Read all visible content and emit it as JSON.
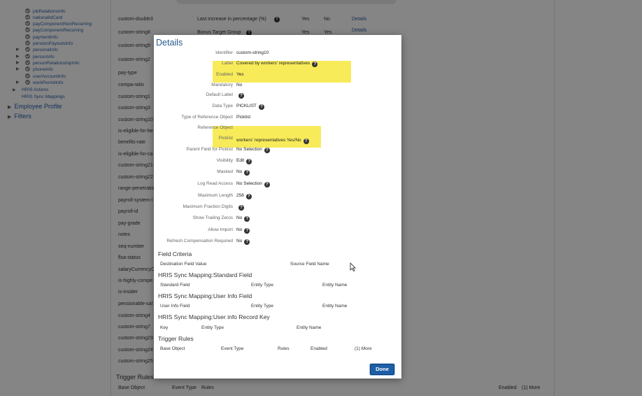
{
  "colors": {
    "link": "#2a5ea8",
    "highlight": "#f7eb5a",
    "done_button": "#1d5fa7",
    "title": "#2a5a8e"
  },
  "sidebar": {
    "tree_items": [
      {
        "label": "jobRelationsInfo",
        "arrow": false
      },
      {
        "label": "nationalIdCard",
        "arrow": false
      },
      {
        "label": "payComponentNonRecurring",
        "arrow": false
      },
      {
        "label": "payComponentRecurring",
        "arrow": false
      },
      {
        "label": "paymentInfo",
        "arrow": false
      },
      {
        "label": "pensionPayoutsInfo",
        "arrow": false
      },
      {
        "label": "personalInfo",
        "arrow": true
      },
      {
        "label": "personInfo",
        "arrow": true
      },
      {
        "label": "personRelationshipInfo",
        "arrow": true
      },
      {
        "label": "phoneInfo",
        "arrow": true
      },
      {
        "label": "userAccountInfo",
        "arrow": false
      },
      {
        "label": "workPermitInfo",
        "arrow": true
      }
    ],
    "hris_actions": "HRIS Actions",
    "hris_sync": "HRIS Sync Mappings",
    "employee_profile": "Employee Profile",
    "filters": "Filters"
  },
  "background": {
    "field_ids": [
      "custom-double3",
      "custom-string8",
      "custom-string9",
      "custom-string2",
      "pay-type",
      "compa-ratio",
      "custom-string1",
      "custom-string3",
      "custom-string10",
      "is-eligible-for-be",
      "benefits-rate",
      "is-eligible-for-ca",
      "custom-string21",
      "custom-string22",
      "range-penetratio",
      "payroll-system-i",
      "payroll-id",
      "pay-grade",
      "notes",
      "seq-number",
      "flsa-status",
      "salaryCurrencyC",
      "is-highly-compe",
      "is-insider",
      "pensionable-sal",
      "custom-string4",
      "custom-string7",
      "custom-string23",
      "custom-string24",
      "custom-string25"
    ],
    "rows": [
      {
        "label": "Last increase in percentage (%)",
        "enabled": "Yes",
        "mandatory": "No",
        "link": "Details"
      },
      {
        "label": "Bonus Target Group",
        "enabled": "Yes",
        "mandatory": "Yes",
        "link": "Details"
      }
    ],
    "trigger_rules_title": "Trigger Rules",
    "trigger_cols": [
      "Base Object",
      "Event Type",
      "Rules"
    ],
    "trigger_right": "Enabled",
    "trigger_more": "(1) More"
  },
  "modal": {
    "title": "Details",
    "fields": [
      {
        "label": "Identifier",
        "value": "custom-string10",
        "help": false
      },
      {
        "label": "Label",
        "value": "Covered by workers' representatives",
        "help": true
      },
      {
        "label": "Enabled",
        "value": "Yes",
        "help": false
      },
      {
        "label": "Mandatory",
        "value": "No",
        "help": false
      },
      {
        "label": "Default Label",
        "value": "",
        "help": true
      },
      {
        "label": "Data Type",
        "value": "PICKLIST",
        "help": true
      },
      {
        "label": "Type of Reference Object",
        "value": "Picklist",
        "help": false
      },
      {
        "label": "Reference Object",
        "value": "",
        "help": false
      },
      {
        "label": "Picklist",
        "value": "workers' representatives Yes/No",
        "help": true
      },
      {
        "label": "Parent Field for Picklist",
        "value": "No Selection",
        "help": true
      },
      {
        "label": "Visibility",
        "value": "Edit",
        "help": true
      },
      {
        "label": "Masked",
        "value": "No",
        "help": true
      },
      {
        "label": "Log Read Access",
        "value": "No Selection",
        "help": true
      },
      {
        "label": "Maximum Length",
        "value": "256",
        "help": true
      },
      {
        "label": "Maximum Fraction Digits",
        "value": "",
        "help": true
      },
      {
        "label": "Show Trailing Zeros",
        "value": "No",
        "help": true
      },
      {
        "label": "Allow Import",
        "value": "No",
        "help": true
      },
      {
        "label": "Refresh Compensation Required",
        "value": "No",
        "help": true
      }
    ],
    "help_glyph": "?",
    "sections": [
      {
        "title": "Field Criteria",
        "cols": [
          "Destination Field Value",
          "Source Field Name"
        ]
      },
      {
        "title": "HRIS Sync Mapping:Standard Field",
        "cols": [
          "Standard Field",
          "Entity Type",
          "Entity Name"
        ]
      },
      {
        "title": "HRIS Sync Mapping:User Info Field",
        "cols": [
          "User Info Field",
          "Entity Type",
          "Entity Name"
        ]
      },
      {
        "title": "HRIS Sync Mapping:User info Record Key",
        "cols": [
          "Key",
          "Entity Type",
          "Entity Name"
        ]
      },
      {
        "title": "Trigger Rules",
        "cols": [
          "Base Object",
          "Event Type",
          "Rules",
          "Enabled",
          "(1) More"
        ]
      }
    ],
    "done": "Done"
  }
}
